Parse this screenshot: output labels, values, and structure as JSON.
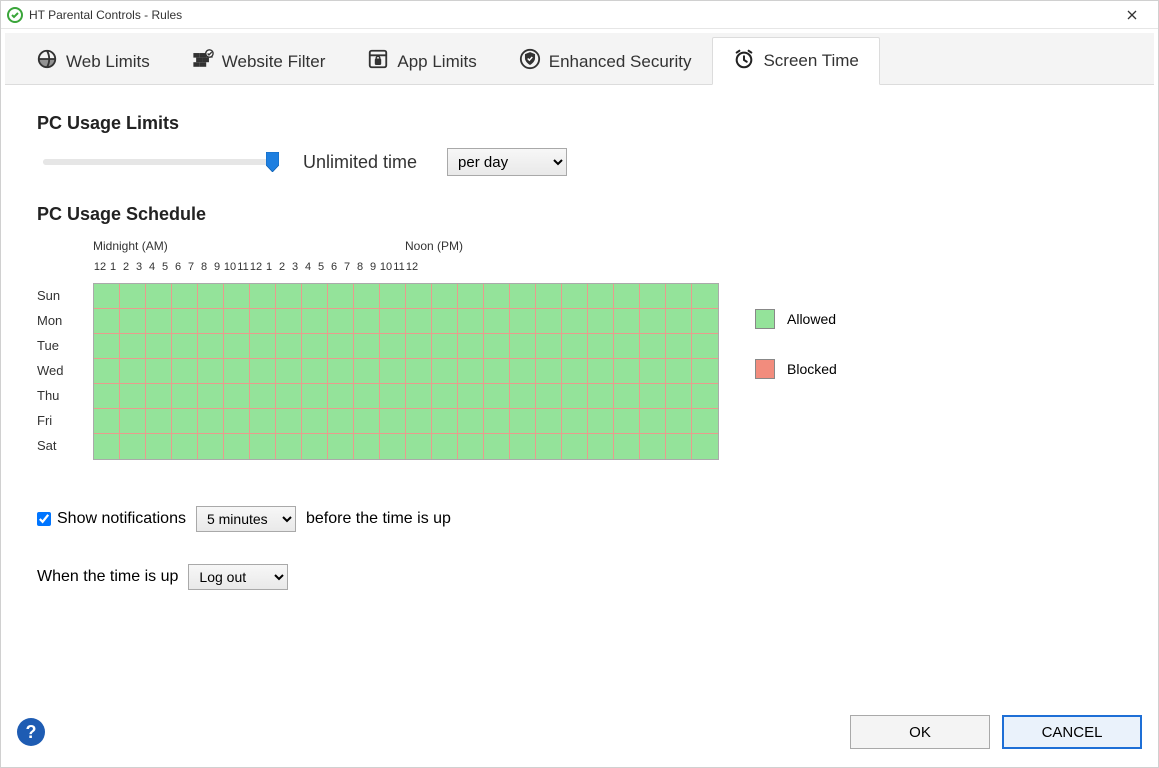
{
  "window": {
    "title": "HT Parental Controls - Rules"
  },
  "tabs": [
    {
      "label": "Web Limits"
    },
    {
      "label": "Website Filter"
    },
    {
      "label": "App Limits"
    },
    {
      "label": "Enhanced Security"
    },
    {
      "label": "Screen Time"
    }
  ],
  "active_tab": 4,
  "limits": {
    "heading": "PC Usage Limits",
    "slider_value_label": "Unlimited time",
    "period_select": "per day"
  },
  "schedule": {
    "heading": "PC Usage Schedule",
    "period_midnight": "Midnight (AM)",
    "period_noon": "Noon (PM)",
    "hours": [
      "12",
      "1",
      "2",
      "3",
      "4",
      "5",
      "6",
      "7",
      "8",
      "9",
      "10",
      "11",
      "12",
      "1",
      "2",
      "3",
      "4",
      "5",
      "6",
      "7",
      "8",
      "9",
      "10",
      "11",
      "12"
    ],
    "days": [
      "Sun",
      "Mon",
      "Tue",
      "Wed",
      "Thu",
      "Fri",
      "Sat"
    ],
    "legend_allowed": "Allowed",
    "legend_blocked": "Blocked"
  },
  "options": {
    "show_notifications_label": "Show notifications",
    "show_notifications_checked": true,
    "notify_lead_select": "5 minutes",
    "notify_suffix": "before the time is up",
    "when_up_label": "When the time is up",
    "when_up_select": "Log out"
  },
  "footer": {
    "ok": "OK",
    "cancel": "CANCEL"
  }
}
